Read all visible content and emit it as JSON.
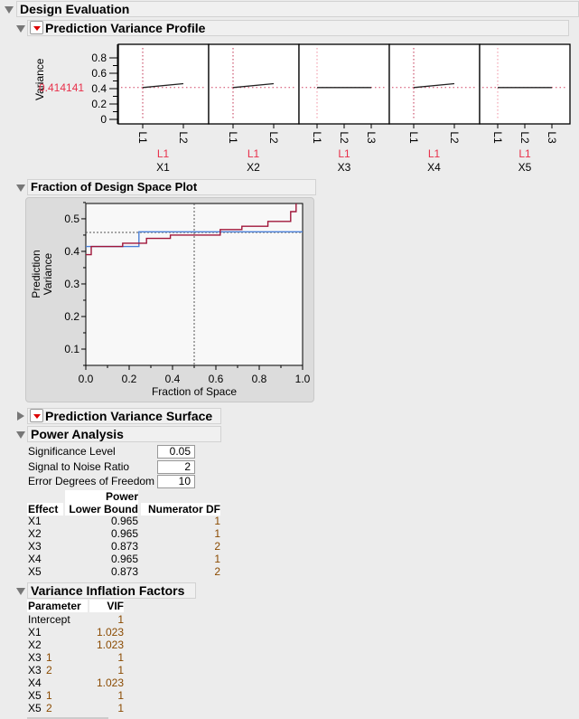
{
  "outline": {
    "title": "Design Evaluation"
  },
  "profile": {
    "title": "Prediction Variance Profile",
    "y_label": "Variance",
    "current_value": "0.414141",
    "y_ticks": [
      "0.8",
      "0.6",
      "0.4",
      "0.2",
      "0"
    ],
    "ylim": [
      0,
      0.9
    ],
    "current_color": "#e8304a",
    "factors": [
      {
        "name": "X1",
        "current": "L1",
        "levels": [
          "L1",
          "L2"
        ],
        "values": [
          0.414,
          0.465
        ]
      },
      {
        "name": "X2",
        "current": "L1",
        "levels": [
          "L1",
          "L2"
        ],
        "values": [
          0.414,
          0.465
        ]
      },
      {
        "name": "X3",
        "current": "L1",
        "levels": [
          "L1",
          "L2",
          "L3"
        ],
        "values": [
          0.414,
          0.414,
          0.414
        ]
      },
      {
        "name": "X4",
        "current": "L1",
        "levels": [
          "L1",
          "L2"
        ],
        "values": [
          0.414,
          0.465
        ]
      },
      {
        "name": "X5",
        "current": "L1",
        "levels": [
          "L1",
          "L2",
          "L3"
        ],
        "values": [
          0.414,
          0.414,
          0.414
        ]
      }
    ]
  },
  "fds": {
    "title": "Fraction of Design Space Plot",
    "chart_data": {
      "type": "line",
      "xlabel": "Fraction of Space",
      "ylabel": "Prediction Variance",
      "xlim": [
        0,
        1
      ],
      "ylim": [
        0.05,
        0.547
      ],
      "x_ticks": [
        "0.0",
        "0.2",
        "0.4",
        "0.6",
        "0.8",
        "1.0"
      ],
      "y_ticks": [
        "0.5",
        "0.4",
        "0.3",
        "0.2",
        "0.1"
      ],
      "reference": {
        "x": 0.5,
        "y": 0.458
      },
      "series": [
        {
          "color": "#4a7fd6",
          "steps": [
            [
              0,
              0.415
            ],
            [
              0.245,
              0.415
            ],
            [
              0.245,
              0.46
            ],
            [
              1,
              0.46
            ]
          ]
        },
        {
          "color": "#a0163a",
          "steps": [
            [
              0,
              0.39
            ],
            [
              0.025,
              0.39
            ],
            [
              0.025,
              0.415
            ],
            [
              0.17,
              0.415
            ],
            [
              0.17,
              0.425
            ],
            [
              0.28,
              0.425
            ],
            [
              0.28,
              0.44
            ],
            [
              0.39,
              0.44
            ],
            [
              0.39,
              0.45
            ],
            [
              0.62,
              0.45
            ],
            [
              0.62,
              0.467
            ],
            [
              0.72,
              0.467
            ],
            [
              0.72,
              0.477
            ],
            [
              0.84,
              0.477
            ],
            [
              0.84,
              0.492
            ],
            [
              0.945,
              0.492
            ],
            [
              0.945,
              0.522
            ],
            [
              0.97,
              0.522
            ],
            [
              0.97,
              0.547
            ]
          ]
        }
      ]
    }
  },
  "surface": {
    "title": "Prediction Variance Surface"
  },
  "power": {
    "title": "Power Analysis",
    "fields": [
      {
        "label": "Significance Level",
        "value": "0.05"
      },
      {
        "label": "Signal to Noise Ratio",
        "value": "2"
      },
      {
        "label": "Error Degrees of Freedom",
        "value": "10"
      }
    ],
    "headers": {
      "effect": "Effect",
      "power1": "Power",
      "power2": "Lower Bound",
      "df": "Numerator DF"
    },
    "rows": [
      {
        "effect": "X1",
        "power": "0.965",
        "df": "1"
      },
      {
        "effect": "X2",
        "power": "0.965",
        "df": "1"
      },
      {
        "effect": "X3",
        "power": "0.873",
        "df": "2"
      },
      {
        "effect": "X4",
        "power": "0.965",
        "df": "1"
      },
      {
        "effect": "X5",
        "power": "0.873",
        "df": "2"
      }
    ]
  },
  "vif": {
    "title": "Variance Inflation Factors",
    "headers": {
      "param": "Parameter",
      "vif": "VIF"
    },
    "rows": [
      {
        "param": "Intercept",
        "level": "",
        "vif": "1"
      },
      {
        "param": "X1",
        "level": "",
        "vif": "1.023"
      },
      {
        "param": "X2",
        "level": "",
        "vif": "1.023"
      },
      {
        "param": "X3",
        "level": "1",
        "vif": "1"
      },
      {
        "param": "X3",
        "level": "2",
        "vif": "1"
      },
      {
        "param": "X4",
        "level": "",
        "vif": "1.023"
      },
      {
        "param": "X5",
        "level": "1",
        "vif": "1"
      },
      {
        "param": "X5",
        "level": "2",
        "vif": "1"
      }
    ]
  }
}
